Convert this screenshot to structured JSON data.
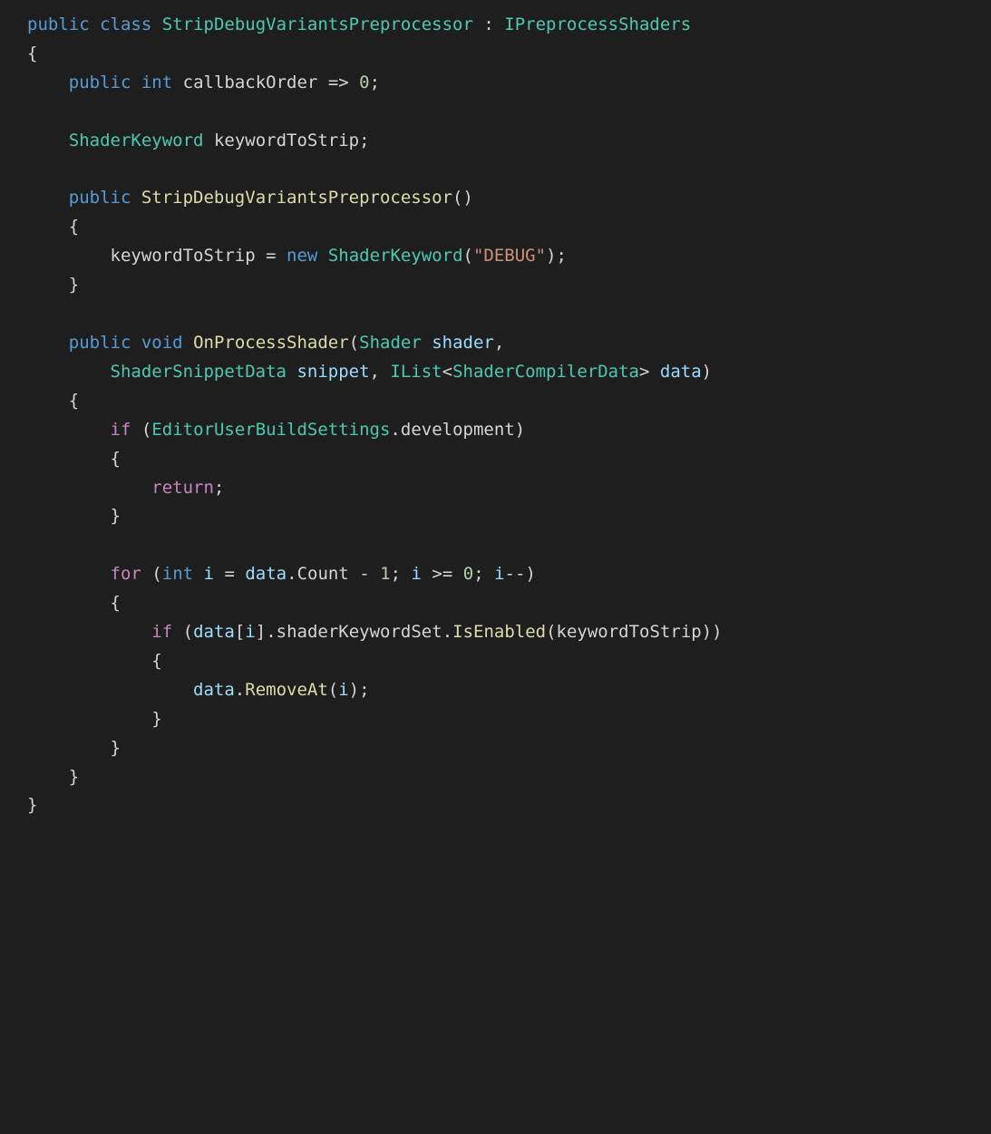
{
  "code": {
    "lang": "csharp",
    "tokens": {
      "keywords": {
        "public": "public",
        "class": "class",
        "int": "int",
        "void": "void",
        "new": "new"
      },
      "control": {
        "if": "if",
        "return": "return",
        "for": "for"
      },
      "types": {
        "className": "StripDebugVariantsPreprocessor",
        "interface": "IPreprocessShaders",
        "shaderKeyword": "ShaderKeyword",
        "shader": "Shader",
        "shaderSnippetData": "ShaderSnippetData",
        "ilist": "IList",
        "shaderCompilerData": "ShaderCompilerData",
        "editorUserBuildSettings": "EditorUserBuildSettings"
      },
      "members": {
        "callbackOrder": "callbackOrder",
        "keywordToStrip": "keywordToStrip",
        "onProcessShader": "OnProcessShader",
        "shaderParam": "shader",
        "snippet": "snippet",
        "data": "data",
        "development": "development",
        "i": "i",
        "count": "Count",
        "shaderKeywordSet": "shaderKeywordSet",
        "isEnabled": "IsEnabled",
        "removeAt": "RemoveAt"
      },
      "literals": {
        "zero": "0",
        "one": "1",
        "debugStr": "\"DEBUG\""
      },
      "ops": {
        "colon": ":",
        "arrow": "=>",
        "semi": ";",
        "openBrace": "{",
        "closeBrace": "}",
        "openParen": "(",
        "closeParen": ")",
        "openBracket": "[",
        "closeBracket": "]",
        "assign": "=",
        "dot": ".",
        "comma": ",",
        "lt": "<",
        "gt": ">",
        "minus": "-",
        "gte": ">=",
        "decr": "--"
      }
    }
  }
}
